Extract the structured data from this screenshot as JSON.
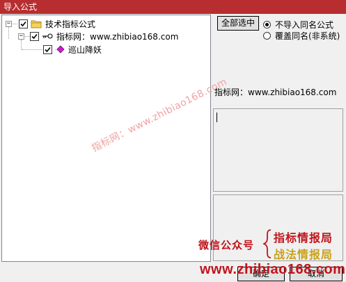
{
  "window": {
    "title": "导入公式"
  },
  "tree": {
    "root": {
      "label": "技术指标公式",
      "checked": true,
      "expanded": true
    },
    "group": {
      "label": "指标网：www.zhibiao168.com",
      "checked": true,
      "expanded": true
    },
    "item": {
      "label": "巡山降妖",
      "checked": true
    }
  },
  "controls": {
    "select_all_label": "全部选中",
    "radio_options": [
      {
        "label": "不导入同名公式",
        "selected": true
      },
      {
        "label": "覆盖同名(非系统)",
        "selected": false
      }
    ]
  },
  "detail": {
    "source_label": "指标网：www.zhibiao168.com"
  },
  "watermark": {
    "text": "指标网：www.zhibiao168.com"
  },
  "promo": {
    "wechat_label": "微信公众号",
    "line1": "指标情报局",
    "line2": "战法情报局",
    "url": "www.zhibiao168.com"
  },
  "buttons": {
    "ok_label": "确定",
    "cancel_label": "取消"
  },
  "colors": {
    "titlebar": "#b82d2f",
    "promo_red": "#c0141c",
    "promo_gold": "#c9a21a",
    "watermark": "#f2a1a1"
  }
}
